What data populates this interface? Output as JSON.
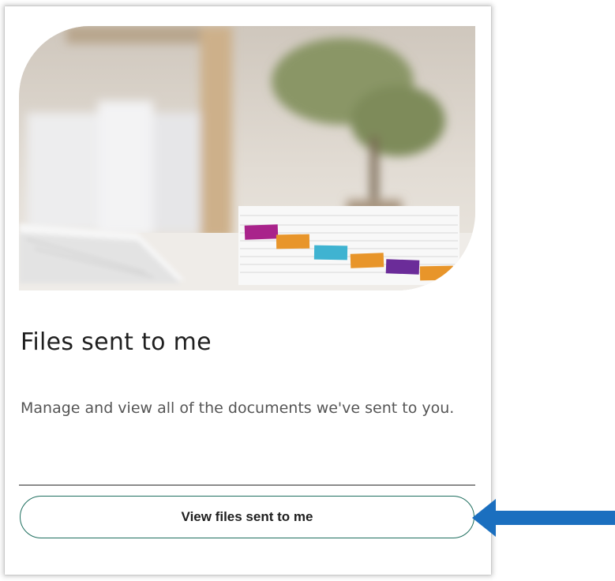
{
  "card": {
    "title": "Files sent to me",
    "description": "Manage and view all of the documents we've sent to you.",
    "button_label": "View files sent to me"
  },
  "colors": {
    "button_border": "#1f6f5f",
    "arrow": "#1b6fbf",
    "title_text": "#1f1f1f",
    "description_text": "#555555"
  },
  "icons": {
    "arrow": "arrow-left-icon"
  }
}
